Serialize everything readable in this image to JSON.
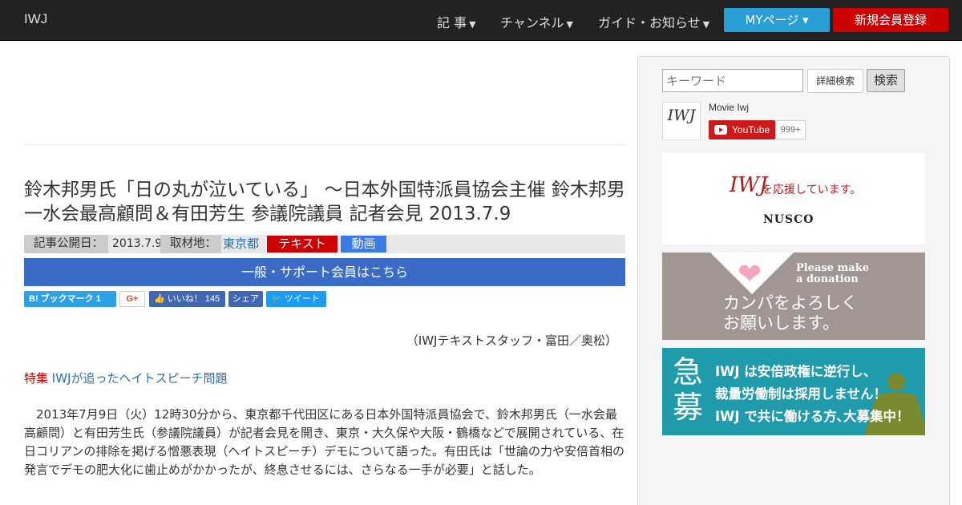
{
  "navbar": {
    "brand": "IWJ",
    "items": [
      {
        "label": "記 事"
      },
      {
        "label": "チャンネル"
      },
      {
        "label": "ガイド・お知らせ"
      }
    ],
    "mypage_label": "MYページ ▾",
    "register_label": "新規会員登録"
  },
  "article": {
    "title": "鈴木邦男氏「日の丸が泣いている」 ～日本外国特派員協会主催 鈴木邦男 一水会最高顧問＆有田芳生 参議院議員 記者会見 2013.7.9",
    "published_label": "記事公開日：",
    "published_date": "2013.7.9",
    "location_label": "取材地：",
    "location": "東京都",
    "tag_text": "テキスト",
    "tag_video": "動画",
    "member_banner": "一般・サポート会員はこちら",
    "credit": "（IWJテキストスタッフ・富田／奥松）",
    "feature_label": "特集",
    "feature_link": "IWJが追ったヘイトスピーチ問題",
    "body": "　2013年7月9日（火）12時30分から、東京都千代田区にある日本外国特派員協会で、鈴木邦男氏（一水会最高顧問）と有田芳生氏（参議院議員）が記者会見を開き、東京・大久保や大阪・鶴橋などで展開されている、在日コリアンの排除を掲げる憎悪表現（ヘイトスピーチ）デモについて語った。有田氏は「世論の力や安倍首相の発言でデモの肥大化に歯止めがかかったが、終息させるには、さらなる一手が必要」と話した。"
  },
  "share": {
    "hatena": "B! ブックマーク  1",
    "gplus": "G+",
    "like": "いいね！ 145",
    "fb_share": "シェア",
    "tweet": "ツイート"
  },
  "sidebar": {
    "search_placeholder": "キーワード",
    "advanced_search": "詳細検索",
    "search_button": "検索",
    "youtube": {
      "channel_logo": "IWJ",
      "channel_name": "Movie Iwj",
      "button_label": "YouTube",
      "subscriber_count": "999+"
    },
    "ad_nusco": {
      "logo": "IWJ",
      "text": "を応援しています。",
      "sponsor": "NUSCO"
    },
    "ad_donate": {
      "please_line1": "Please make",
      "please_line2": "a donation",
      "kanpa_line1": "カンパをよろしく",
      "kanpa_line2": "お願いします。"
    },
    "ad_recruit": {
      "kyu": "急",
      "bo": "募",
      "line1": "IWJ は安倍政権に逆行し、",
      "line2": "裁量労働制は採用しません！",
      "line3": "IWJ で共に働ける方､大募集中！"
    }
  },
  "colors": {
    "navbar_bg": "#222222",
    "mypage_blue": "#2a9fd6",
    "register_red": "#cc0000",
    "member_bar_blue": "#3a6bc7",
    "recruit_teal": "#1f9bab"
  }
}
